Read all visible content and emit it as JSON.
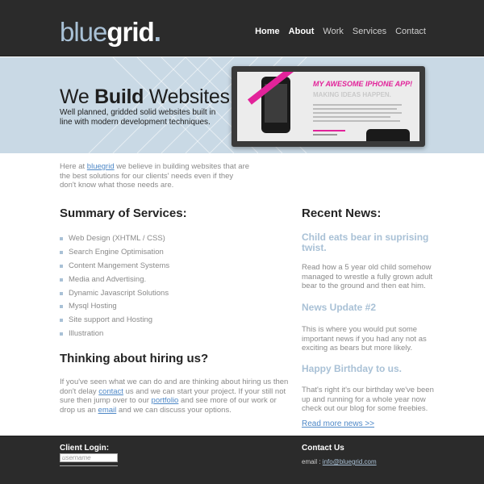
{
  "logo": {
    "part1": "blue",
    "part2": "grid",
    "part3": "."
  },
  "nav": [
    {
      "label": "Home",
      "active": true
    },
    {
      "label": "About",
      "active": false
    },
    {
      "label": "Work",
      "active": false
    },
    {
      "label": "Services",
      "active": false
    },
    {
      "label": "Contact",
      "active": false
    }
  ],
  "hero": {
    "title_pre": "We ",
    "title_bold": "Build",
    "title_post": " Websites",
    "subtitle": "Well planned, gridded solid websites built in line with modern development techniques.",
    "screenshot": {
      "app_title": "MY AWESOME IPHONE APP!",
      "app_subtitle": "MAKING IDEAS HAPPEN."
    }
  },
  "intro": {
    "pre": "Here at ",
    "link": "bluegrid",
    "post": " we believe in building websites that are the best solutions for our clients' needs even if they don't know what those needs are."
  },
  "services": {
    "heading": "Summary of Services:",
    "items": [
      "Web Design (XHTML / CSS)",
      "Search Engine Optimisation",
      "Content Mangement Systems",
      "Media and Advertising.",
      "Dynamic Javascript Solutions",
      "Mysql Hosting",
      "Site support and Hosting",
      "Illustration"
    ]
  },
  "hire": {
    "heading": "Thinking about hiring us?",
    "t1": "If you've seen what we can do and are thinking about hiring us then don't delay ",
    "l1": "contact",
    "t2": " us and we can start your project. If your still not sure then jump over to our ",
    "l2": "portfolio",
    "t3": " and see more of our work or drop us an ",
    "l3": "email",
    "t4": " and we can discuss your options."
  },
  "news": {
    "heading": "Recent News:",
    "items": [
      {
        "title": "Child eats bear in suprising twist.",
        "body": "Read how a 5 year old child somehow managed to wrestle a fully grown adult bear to the ground and then eat him."
      },
      {
        "title": "News Update #2",
        "body": "This is where you would put some important news if you had any not as exciting as bears but more likely."
      },
      {
        "title": "Happy Birthday to us.",
        "body": "That's right it's our birthday we've been up and running for a whole year now check out our blog for some freebies."
      }
    ],
    "read_more": "Read more news >>"
  },
  "footer": {
    "login_heading": "Client Login:",
    "username_placeholder": "username",
    "contact_heading": "Contact Us",
    "email_label": "email : ",
    "email": "info@bluegrid.com"
  },
  "colors": {
    "accent": "#a9c1d6",
    "dark": "#2b2b2b",
    "link": "#4e88c7",
    "pink": "#e2239a"
  }
}
